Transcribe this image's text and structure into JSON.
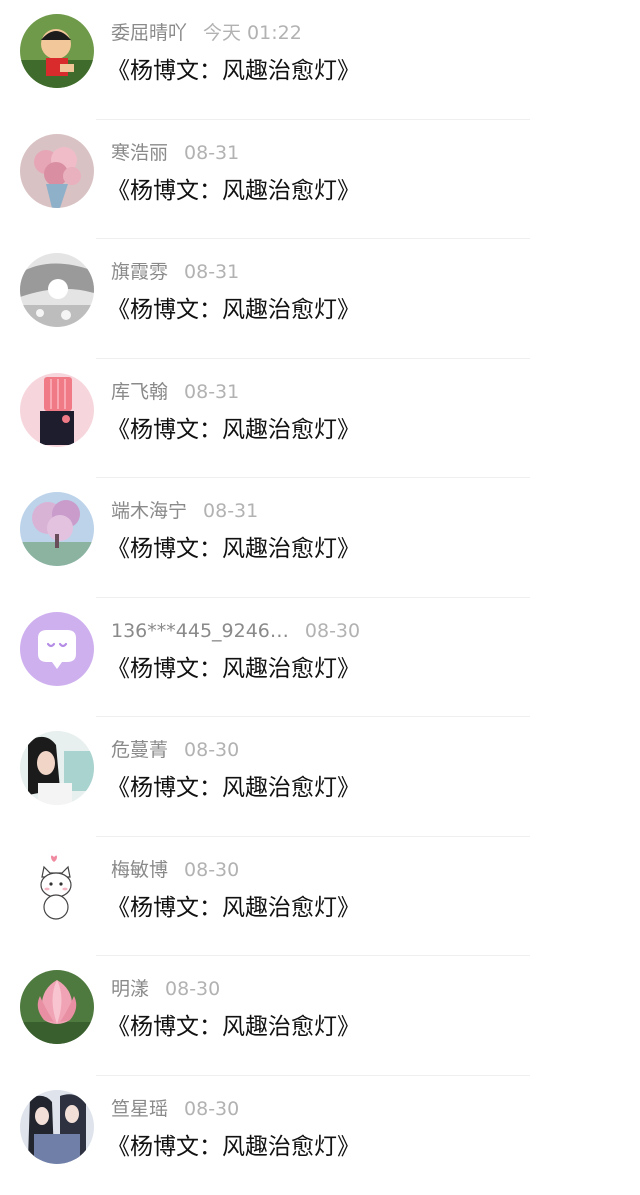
{
  "comments": [
    {
      "username": "委屈晴吖",
      "time": "今天 01:22",
      "content": "《杨博文：风趣治愈灯》",
      "avatar_icon": "cartoon-boy-avatar-icon"
    },
    {
      "username": "寒浩丽",
      "time": "08-31",
      "content": "《杨博文：风趣治愈灯》",
      "avatar_icon": "flower-bouquet-avatar-icon"
    },
    {
      "username": "旗霞雰",
      "time": "08-31",
      "content": "《杨博文：风趣治愈灯》",
      "avatar_icon": "grayscale-photo-avatar-icon"
    },
    {
      "username": "库飞翰",
      "time": "08-31",
      "content": "《杨博文：风趣治愈灯》",
      "avatar_icon": "pink-box-avatar-icon"
    },
    {
      "username": "端木海宁",
      "time": "08-31",
      "content": "《杨博文：风趣治愈灯》",
      "avatar_icon": "cherry-tree-avatar-icon"
    },
    {
      "username": "136***445_9246…",
      "time": "08-30",
      "content": "《杨博文：风趣治愈灯》",
      "avatar_icon": "default-chat-bubble-avatar-icon"
    },
    {
      "username": "危蔓菁",
      "time": "08-30",
      "content": "《杨博文：风趣治愈灯》",
      "avatar_icon": "girl-portrait-avatar-icon"
    },
    {
      "username": "梅敏博",
      "time": "08-30",
      "content": "《杨博文：风趣治愈灯》",
      "avatar_icon": "white-cat-avatar-icon"
    },
    {
      "username": "明漾",
      "time": "08-30",
      "content": "《杨博文：风趣治愈灯》",
      "avatar_icon": "lotus-flower-avatar-icon"
    },
    {
      "username": "笪星瑶",
      "time": "08-30",
      "content": "《杨博文：风趣治愈灯》",
      "avatar_icon": "anime-couple-avatar-icon"
    }
  ]
}
